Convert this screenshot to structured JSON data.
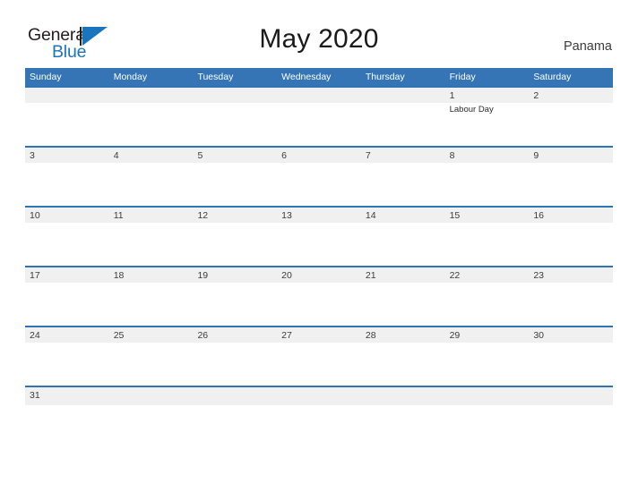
{
  "brand": {
    "word_one": "General",
    "word_two": "Blue",
    "triangle_icon": "triangle-logo-icon",
    "color_dark": "#231f20",
    "color_blue": "#1b75bc"
  },
  "header": {
    "title": "May 2020",
    "country": "Panama"
  },
  "theme": {
    "header_blue": "#3575b5",
    "divider_blue": "#2e75b6",
    "band_grey": "#f0f0f0",
    "text_dark": "#3b3b3b"
  },
  "calendar": {
    "weekdays": [
      "Sunday",
      "Monday",
      "Tuesday",
      "Wednesday",
      "Thursday",
      "Friday",
      "Saturday"
    ],
    "weeks": [
      [
        {
          "num": "",
          "event": ""
        },
        {
          "num": "",
          "event": ""
        },
        {
          "num": "",
          "event": ""
        },
        {
          "num": "",
          "event": ""
        },
        {
          "num": "",
          "event": ""
        },
        {
          "num": "1",
          "event": "Labour Day"
        },
        {
          "num": "2",
          "event": ""
        }
      ],
      [
        {
          "num": "3",
          "event": ""
        },
        {
          "num": "4",
          "event": ""
        },
        {
          "num": "5",
          "event": ""
        },
        {
          "num": "6",
          "event": ""
        },
        {
          "num": "7",
          "event": ""
        },
        {
          "num": "8",
          "event": ""
        },
        {
          "num": "9",
          "event": ""
        }
      ],
      [
        {
          "num": "10",
          "event": ""
        },
        {
          "num": "11",
          "event": ""
        },
        {
          "num": "12",
          "event": ""
        },
        {
          "num": "13",
          "event": ""
        },
        {
          "num": "14",
          "event": ""
        },
        {
          "num": "15",
          "event": ""
        },
        {
          "num": "16",
          "event": ""
        }
      ],
      [
        {
          "num": "17",
          "event": ""
        },
        {
          "num": "18",
          "event": ""
        },
        {
          "num": "19",
          "event": ""
        },
        {
          "num": "20",
          "event": ""
        },
        {
          "num": "21",
          "event": ""
        },
        {
          "num": "22",
          "event": ""
        },
        {
          "num": "23",
          "event": ""
        }
      ],
      [
        {
          "num": "24",
          "event": ""
        },
        {
          "num": "25",
          "event": ""
        },
        {
          "num": "26",
          "event": ""
        },
        {
          "num": "27",
          "event": ""
        },
        {
          "num": "28",
          "event": ""
        },
        {
          "num": "29",
          "event": ""
        },
        {
          "num": "30",
          "event": ""
        }
      ],
      [
        {
          "num": "31",
          "event": ""
        },
        {
          "num": "",
          "event": ""
        },
        {
          "num": "",
          "event": ""
        },
        {
          "num": "",
          "event": ""
        },
        {
          "num": "",
          "event": ""
        },
        {
          "num": "",
          "event": ""
        },
        {
          "num": "",
          "event": ""
        }
      ]
    ]
  }
}
